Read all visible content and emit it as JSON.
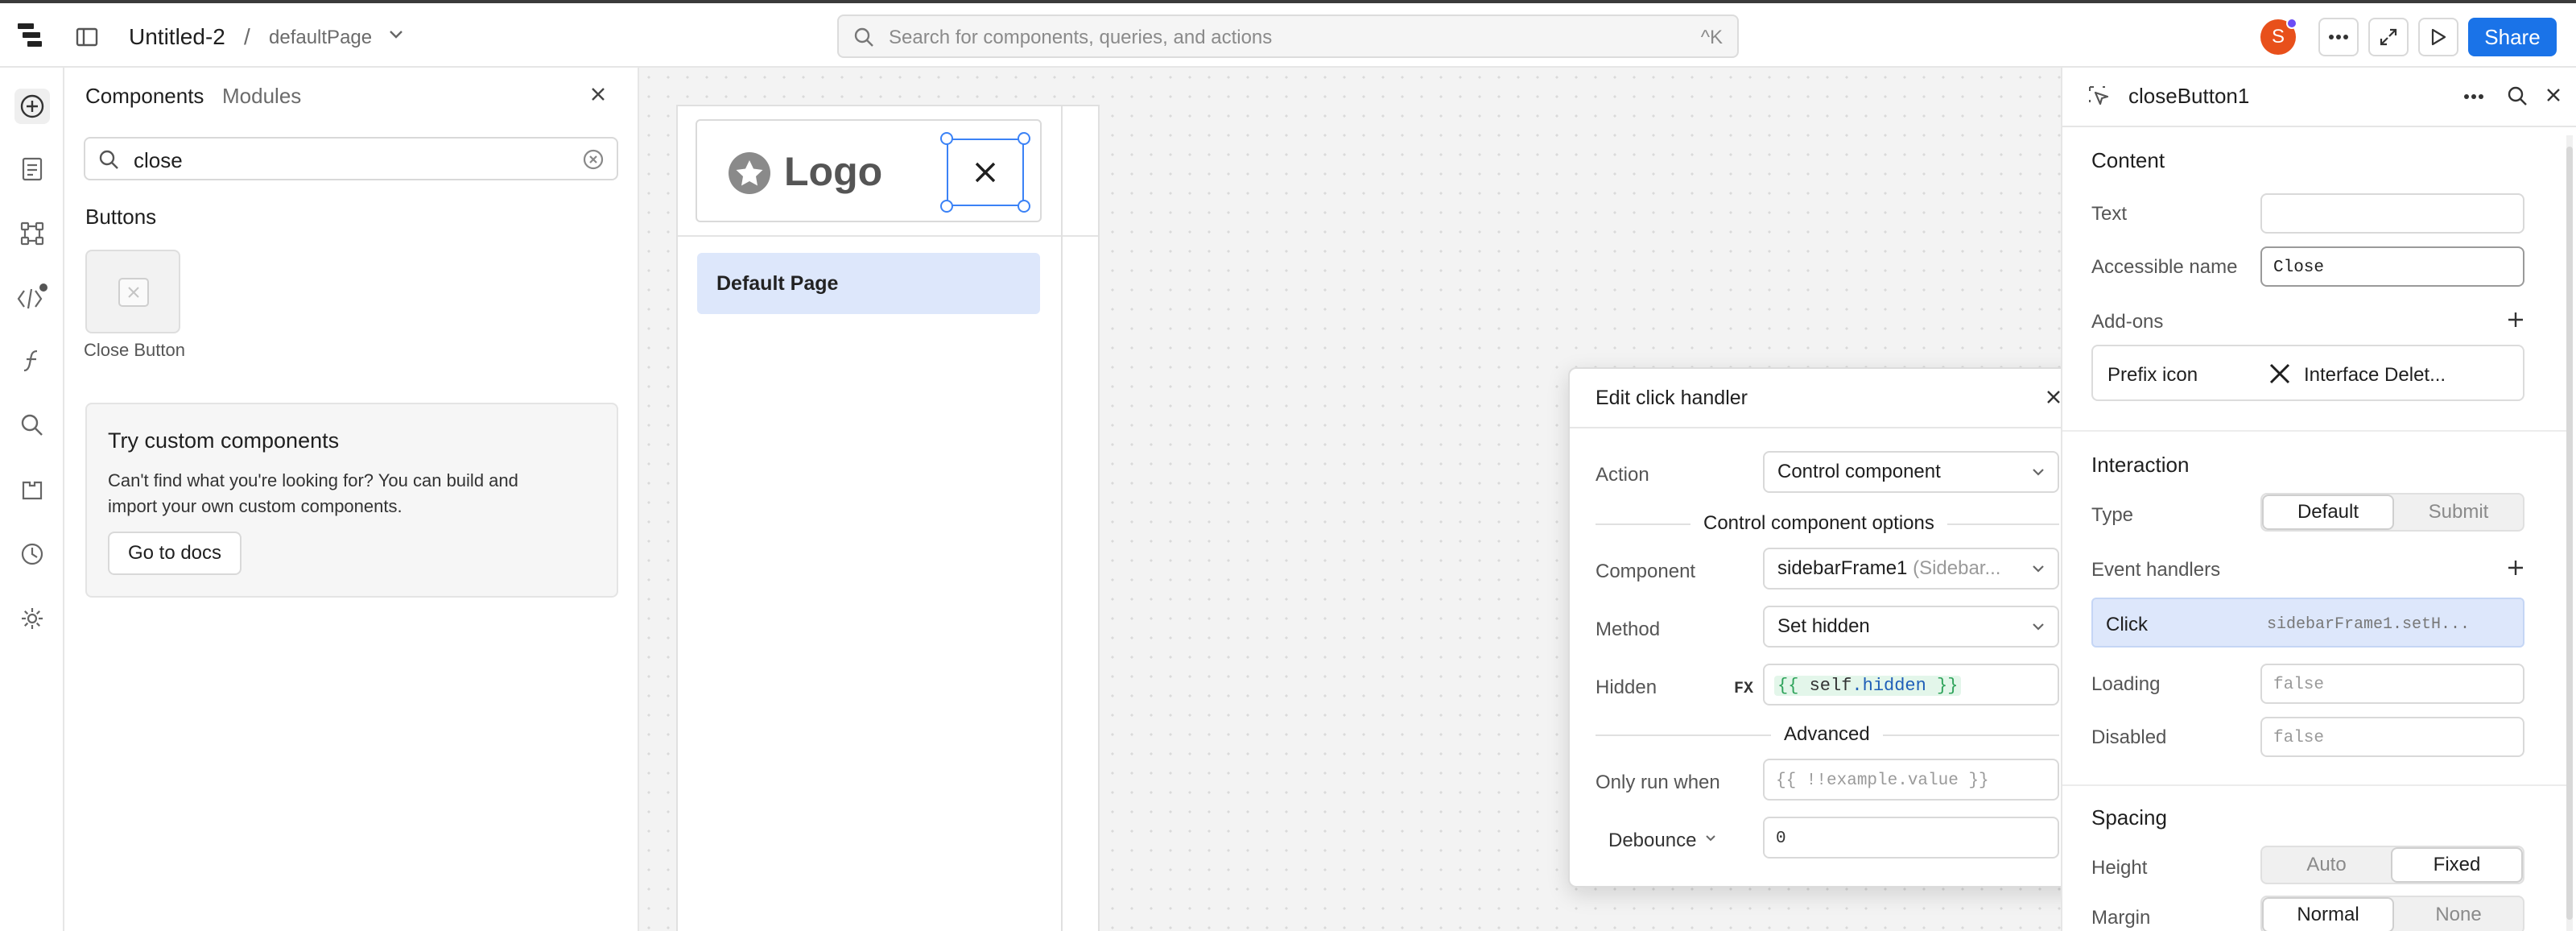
{
  "topbar": {
    "app_title": "Untitled-2",
    "separator": "/",
    "page_name": "defaultPage",
    "search_placeholder": "Search for components, queries, and actions",
    "shortcut": "^K",
    "avatar_letter": "S",
    "share_label": "Share",
    "accent": "#1a73e8"
  },
  "left_panel": {
    "tabs": [
      {
        "label": "Components"
      },
      {
        "label": "Modules"
      }
    ],
    "search_value": "close",
    "section_title": "Buttons",
    "result_label": "Close Button",
    "promo": {
      "title": "Try custom components",
      "line1": "Can't find what you're looking for? You can build and",
      "line2": "import your own custom components.",
      "button": "Go to docs"
    }
  },
  "canvas": {
    "logo_text": "Logo",
    "nav_item": "Default Page"
  },
  "modal": {
    "title": "Edit click handler",
    "action_label": "Action",
    "action_value": "Control component",
    "section1": "Control component options",
    "component_label": "Component",
    "component_value": "sidebarFrame1",
    "component_type": "(Sidebar...",
    "method_label": "Method",
    "method_value": "Set hidden",
    "hidden_label": "Hidden",
    "fx": "FX",
    "hidden_open": "{{",
    "hidden_self": "self",
    "hidden_prop": ".hidden",
    "hidden_close": "}}",
    "section2": "Advanced",
    "only_run_label": "Only run when",
    "only_run_placeholder": "{{ !!example.value }}",
    "debounce_label": "Debounce",
    "debounce_value": "0"
  },
  "inspector": {
    "component_name": "closeButton1",
    "content_title": "Content",
    "text_label": "Text",
    "text_value": "",
    "accessible_label": "Accessible name",
    "accessible_value": "Close",
    "addons_label": "Add-ons",
    "prefix_label": "Prefix icon",
    "prefix_value": "Interface Delet...",
    "interaction_title": "Interaction",
    "type_label": "Type",
    "type_options": [
      "Default",
      "Submit"
    ],
    "event_handlers_label": "Event handlers",
    "handler_event": "Click",
    "handler_action": "sidebarFrame1.setH...",
    "loading_label": "Loading",
    "loading_value": "false",
    "disabled_label": "Disabled",
    "disabled_value": "false",
    "spacing_title": "Spacing",
    "height_label": "Height",
    "height_options": [
      "Auto",
      "Fixed"
    ],
    "margin_label": "Margin",
    "margin_options": [
      "Normal",
      "None"
    ]
  }
}
